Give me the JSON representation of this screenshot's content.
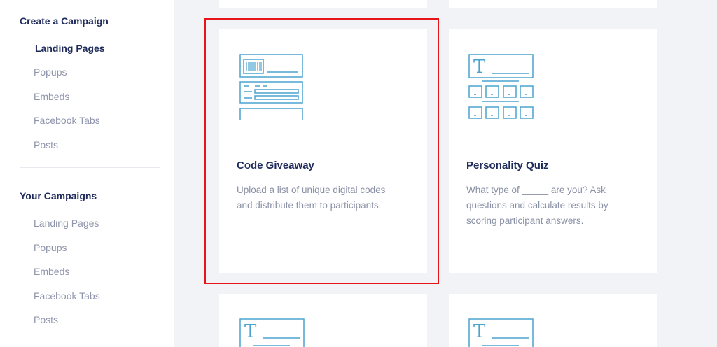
{
  "sidebar": {
    "create_heading": "Create a Campaign",
    "create_items": [
      {
        "label": "Landing Pages",
        "active": true
      },
      {
        "label": "Popups"
      },
      {
        "label": "Embeds"
      },
      {
        "label": "Facebook Tabs"
      },
      {
        "label": "Posts"
      }
    ],
    "yours_heading": "Your Campaigns",
    "yours_items": [
      {
        "label": "Landing Pages"
      },
      {
        "label": "Popups"
      },
      {
        "label": "Embeds"
      },
      {
        "label": "Facebook Tabs"
      },
      {
        "label": "Posts"
      }
    ]
  },
  "cards": [
    {
      "title": "Code Giveaway",
      "description": "Upload a list of unique digital codes and distribute them to participants.",
      "icon": "code-giveaway-icon",
      "highlighted": true
    },
    {
      "title": "Personality Quiz",
      "description": "What type of _____ are you? Ask questions and calculate results by scoring participant answers.",
      "icon": "personality-quiz-icon"
    }
  ],
  "colors": {
    "accent_icon": "#4aa3cf",
    "heading": "#1f2b5b",
    "muted_text": "#8e95ac",
    "highlight_border": "#e8141c",
    "page_bg": "#f2f3f6"
  }
}
